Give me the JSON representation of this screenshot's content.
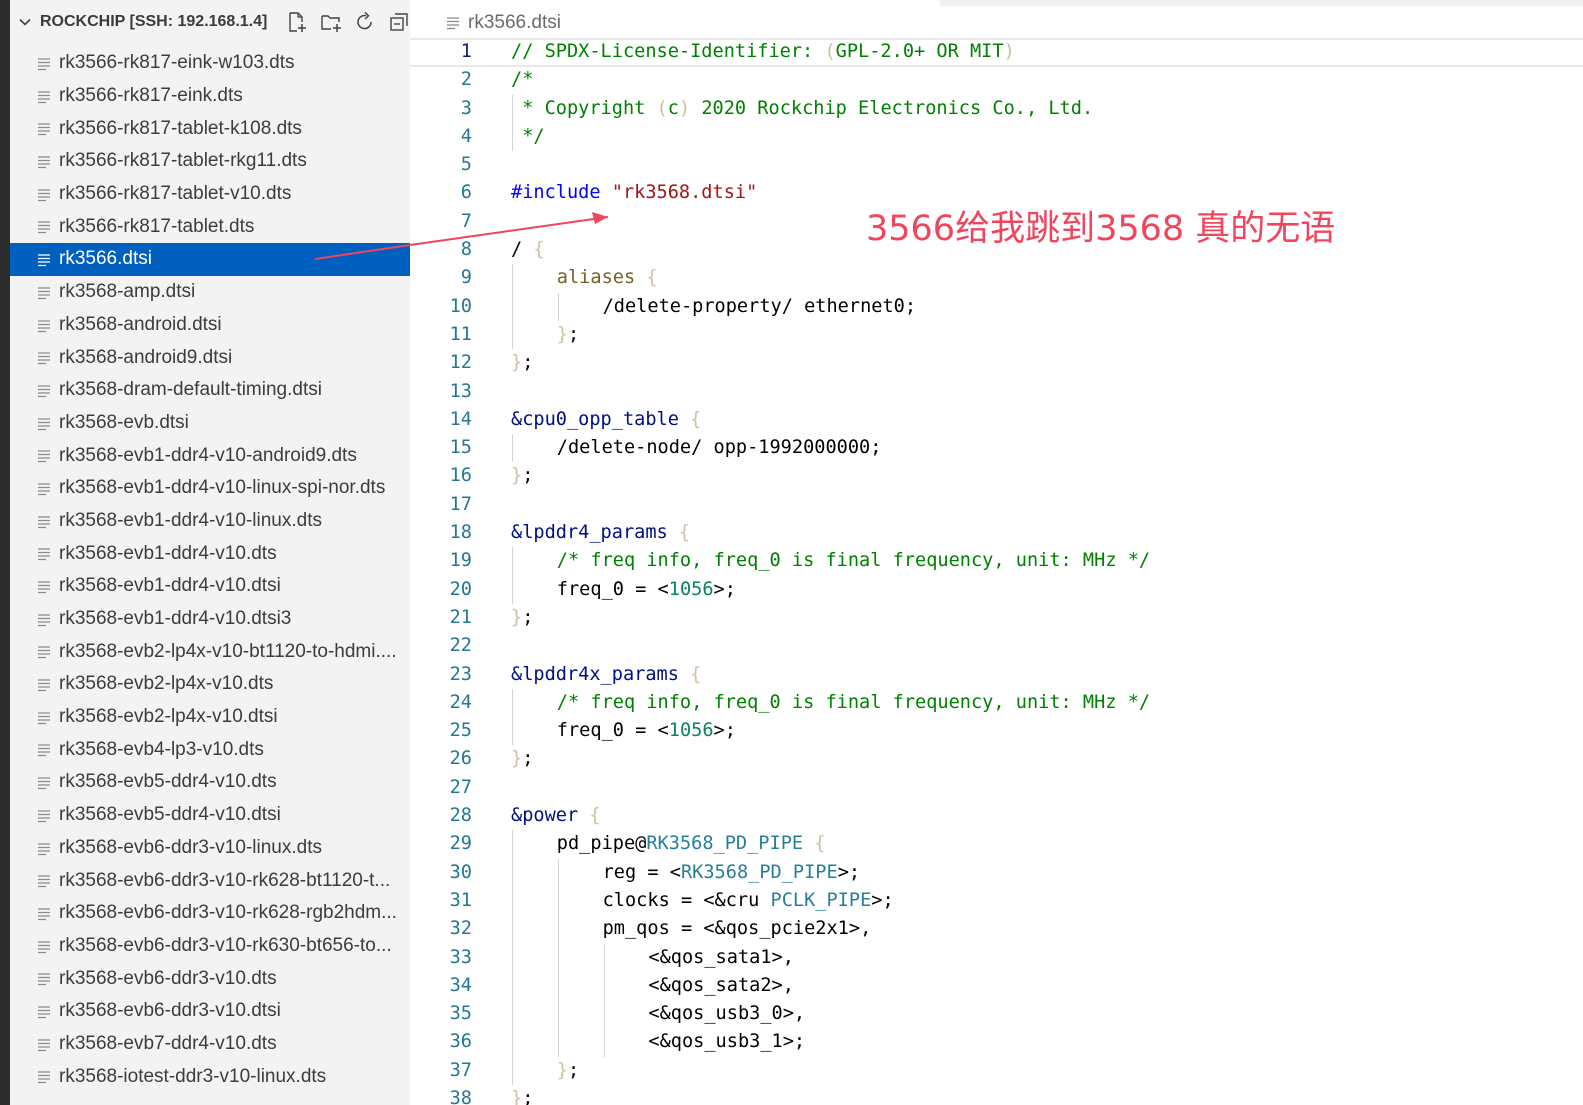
{
  "explorer": {
    "root_title": "ROCKCHIP [SSH: 192.168.1.4]",
    "actions": [
      {
        "name": "new-file-icon"
      },
      {
        "name": "new-folder-icon"
      },
      {
        "name": "refresh-icon"
      },
      {
        "name": "collapse-all-icon"
      }
    ],
    "files": [
      "rk3566-rk817-eink-w103.dts",
      "rk3566-rk817-eink.dts",
      "rk3566-rk817-tablet-k108.dts",
      "rk3566-rk817-tablet-rkg11.dts",
      "rk3566-rk817-tablet-v10.dts",
      "rk3566-rk817-tablet.dts",
      "rk3566.dtsi",
      "rk3568-amp.dtsi",
      "rk3568-android.dtsi",
      "rk3568-android9.dtsi",
      "rk3568-dram-default-timing.dtsi",
      "rk3568-evb.dtsi",
      "rk3568-evb1-ddr4-v10-android9.dts",
      "rk3568-evb1-ddr4-v10-linux-spi-nor.dts",
      "rk3568-evb1-ddr4-v10-linux.dts",
      "rk3568-evb1-ddr4-v10.dts",
      "rk3568-evb1-ddr4-v10.dtsi",
      "rk3568-evb1-ddr4-v10.dtsi3",
      "rk3568-evb2-lp4x-v10-bt1120-to-hdmi....",
      "rk3568-evb2-lp4x-v10.dts",
      "rk3568-evb2-lp4x-v10.dtsi",
      "rk3568-evb4-lp3-v10.dts",
      "rk3568-evb5-ddr4-v10.dts",
      "rk3568-evb5-ddr4-v10.dtsi",
      "rk3568-evb6-ddr3-v10-linux.dts",
      "rk3568-evb6-ddr3-v10-rk628-bt1120-t...",
      "rk3568-evb6-ddr3-v10-rk628-rgb2hdm...",
      "rk3568-evb6-ddr3-v10-rk630-bt656-to...",
      "rk3568-evb6-ddr3-v10.dts",
      "rk3568-evb6-ddr3-v10.dtsi",
      "rk3568-evb7-ddr4-v10.dts",
      "rk3568-iotest-ddr3-v10-linux.dts"
    ],
    "selected_file": "rk3566.dtsi"
  },
  "editor": {
    "breadcrumb": "rk3566.dtsi",
    "active_line": 1,
    "lines": [
      {
        "n": "1",
        "indent": 0,
        "tokens": [
          [
            "c",
            "// SPDX-License-Identifier: "
          ],
          [
            "b2",
            "("
          ],
          [
            "c",
            "GPL-2.0+ OR MIT"
          ],
          [
            "b2",
            ")"
          ]
        ]
      },
      {
        "n": "2",
        "indent": 0,
        "tokens": [
          [
            "c",
            "/*"
          ]
        ]
      },
      {
        "n": "3",
        "indent": 0,
        "tokens": [
          [
            "c",
            " * Copyright "
          ],
          [
            "b2",
            "("
          ],
          [
            "c",
            "c"
          ],
          [
            "b2",
            ")"
          ],
          [
            "c",
            " 2020 Rockchip Electronics Co., Ltd."
          ]
        ]
      },
      {
        "n": "4",
        "indent": 0,
        "tokens": [
          [
            "c",
            " */"
          ]
        ]
      },
      {
        "n": "5",
        "indent": 0,
        "tokens": []
      },
      {
        "n": "6",
        "indent": 0,
        "tokens": [
          [
            "k",
            "#include "
          ],
          [
            "s",
            "\"rk3568.dtsi\""
          ]
        ]
      },
      {
        "n": "7",
        "indent": 0,
        "tokens": []
      },
      {
        "n": "8",
        "indent": 0,
        "tokens": [
          [
            "p",
            "/ "
          ],
          [
            "b2",
            "{"
          ]
        ]
      },
      {
        "n": "9",
        "indent": 1,
        "tokens": [
          [
            "b1",
            "aliases "
          ],
          [
            "b2",
            "{"
          ]
        ]
      },
      {
        "n": "10",
        "indent": 2,
        "tokens": [
          [
            "p",
            "/delete-property/ ethernet0;"
          ]
        ]
      },
      {
        "n": "11",
        "indent": 1,
        "tokens": [
          [
            "b2",
            "}"
          ],
          [
            "p",
            ";"
          ]
        ]
      },
      {
        "n": "12",
        "indent": 0,
        "tokens": [
          [
            "b2",
            "}"
          ],
          [
            "p",
            ";"
          ]
        ]
      },
      {
        "n": "13",
        "indent": 0,
        "tokens": []
      },
      {
        "n": "14",
        "indent": 0,
        "tokens": [
          [
            "n",
            "&cpu0_opp_table "
          ],
          [
            "b2",
            "{"
          ]
        ]
      },
      {
        "n": "15",
        "indent": 1,
        "tokens": [
          [
            "p",
            "/delete-node/ opp-1992000000;"
          ]
        ]
      },
      {
        "n": "16",
        "indent": 0,
        "tokens": [
          [
            "b2",
            "}"
          ],
          [
            "p",
            ";"
          ]
        ]
      },
      {
        "n": "17",
        "indent": 0,
        "tokens": []
      },
      {
        "n": "18",
        "indent": 0,
        "tokens": [
          [
            "n",
            "&lpddr4_params "
          ],
          [
            "b2",
            "{"
          ]
        ]
      },
      {
        "n": "19",
        "indent": 1,
        "tokens": [
          [
            "c",
            "/* freq info, freq_0 is final frequency, unit: MHz */"
          ]
        ]
      },
      {
        "n": "20",
        "indent": 1,
        "tokens": [
          [
            "p",
            "freq_0 = <"
          ],
          [
            "m",
            "1056"
          ],
          [
            "p",
            ">;"
          ]
        ]
      },
      {
        "n": "21",
        "indent": 0,
        "tokens": [
          [
            "b2",
            "}"
          ],
          [
            "p",
            ";"
          ]
        ]
      },
      {
        "n": "22",
        "indent": 0,
        "tokens": []
      },
      {
        "n": "23",
        "indent": 0,
        "tokens": [
          [
            "n",
            "&lpddr4x_params "
          ],
          [
            "b2",
            "{"
          ]
        ]
      },
      {
        "n": "24",
        "indent": 1,
        "tokens": [
          [
            "c",
            "/* freq info, freq_0 is final frequency, unit: MHz */"
          ]
        ]
      },
      {
        "n": "25",
        "indent": 1,
        "tokens": [
          [
            "p",
            "freq_0 = <"
          ],
          [
            "m",
            "1056"
          ],
          [
            "p",
            ">;"
          ]
        ]
      },
      {
        "n": "26",
        "indent": 0,
        "tokens": [
          [
            "b2",
            "}"
          ],
          [
            "p",
            ";"
          ]
        ]
      },
      {
        "n": "27",
        "indent": 0,
        "tokens": []
      },
      {
        "n": "28",
        "indent": 0,
        "tokens": [
          [
            "n",
            "&power "
          ],
          [
            "b2",
            "{"
          ]
        ]
      },
      {
        "n": "29",
        "indent": 1,
        "tokens": [
          [
            "p",
            "pd_pipe@"
          ],
          [
            "mac",
            "RK3568_PD_PIPE"
          ],
          [
            "p",
            " "
          ],
          [
            "b2",
            "{"
          ]
        ]
      },
      {
        "n": "30",
        "indent": 2,
        "tokens": [
          [
            "p",
            "reg = <"
          ],
          [
            "mac",
            "RK3568_PD_PIPE"
          ],
          [
            "p",
            ">;"
          ]
        ]
      },
      {
        "n": "31",
        "indent": 2,
        "tokens": [
          [
            "p",
            "clocks = <&cru "
          ],
          [
            "mac",
            "PCLK_PIPE"
          ],
          [
            "p",
            ">;"
          ]
        ]
      },
      {
        "n": "32",
        "indent": 2,
        "tokens": [
          [
            "p",
            "pm_qos = <&qos_pcie2x1>,"
          ]
        ]
      },
      {
        "n": "33",
        "indent": 3,
        "tokens": [
          [
            "p",
            "<&qos_sata1>,"
          ]
        ]
      },
      {
        "n": "34",
        "indent": 3,
        "tokens": [
          [
            "p",
            "<&qos_sata2>,"
          ]
        ]
      },
      {
        "n": "35",
        "indent": 3,
        "tokens": [
          [
            "p",
            "<&qos_usb3_0>,"
          ]
        ]
      },
      {
        "n": "36",
        "indent": 3,
        "tokens": [
          [
            "p",
            "<&qos_usb3_1>;"
          ]
        ]
      },
      {
        "n": "37",
        "indent": 1,
        "tokens": [
          [
            "b2",
            "}"
          ],
          [
            "p",
            ";"
          ]
        ]
      },
      {
        "n": "38",
        "indent": 0,
        "tokens": [
          [
            "b2",
            "}"
          ],
          [
            "p",
            ";"
          ]
        ]
      }
    ]
  },
  "annotation": {
    "text": "3566给我跳到3568 真的无语",
    "color": "#f0455c"
  },
  "colors": {
    "selection": "#0060c0",
    "sidebar_bg": "#f3f3f3",
    "line_number": "#237893",
    "comment": "#008000",
    "keyword": "#0000ff",
    "string": "#a31515",
    "label": "#001080",
    "number": "#098658",
    "macro": "#267f99"
  }
}
